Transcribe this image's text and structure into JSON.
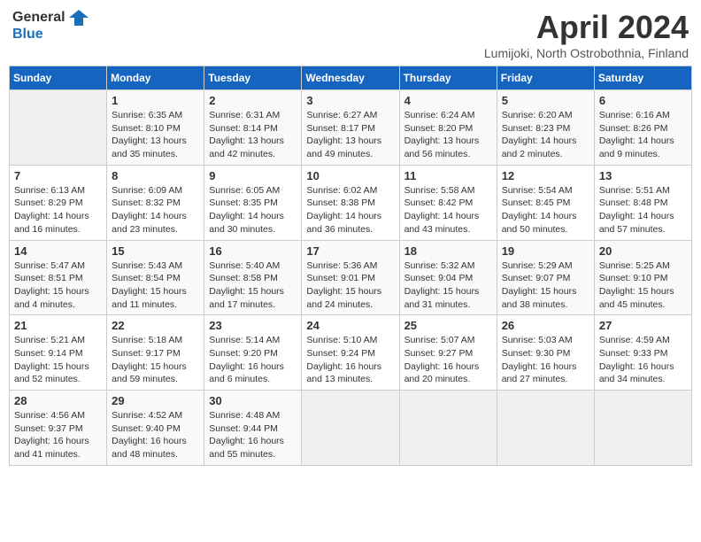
{
  "header": {
    "logo_line1": "General",
    "logo_line2": "Blue",
    "month_title": "April 2024",
    "location": "Lumijoki, North Ostrobothnia, Finland"
  },
  "days_of_week": [
    "Sunday",
    "Monday",
    "Tuesday",
    "Wednesday",
    "Thursday",
    "Friday",
    "Saturday"
  ],
  "weeks": [
    [
      {
        "day": "",
        "info": ""
      },
      {
        "day": "1",
        "info": "Sunrise: 6:35 AM\nSunset: 8:10 PM\nDaylight: 13 hours\nand 35 minutes."
      },
      {
        "day": "2",
        "info": "Sunrise: 6:31 AM\nSunset: 8:14 PM\nDaylight: 13 hours\nand 42 minutes."
      },
      {
        "day": "3",
        "info": "Sunrise: 6:27 AM\nSunset: 8:17 PM\nDaylight: 13 hours\nand 49 minutes."
      },
      {
        "day": "4",
        "info": "Sunrise: 6:24 AM\nSunset: 8:20 PM\nDaylight: 13 hours\nand 56 minutes."
      },
      {
        "day": "5",
        "info": "Sunrise: 6:20 AM\nSunset: 8:23 PM\nDaylight: 14 hours\nand 2 minutes."
      },
      {
        "day": "6",
        "info": "Sunrise: 6:16 AM\nSunset: 8:26 PM\nDaylight: 14 hours\nand 9 minutes."
      }
    ],
    [
      {
        "day": "7",
        "info": "Sunrise: 6:13 AM\nSunset: 8:29 PM\nDaylight: 14 hours\nand 16 minutes."
      },
      {
        "day": "8",
        "info": "Sunrise: 6:09 AM\nSunset: 8:32 PM\nDaylight: 14 hours\nand 23 minutes."
      },
      {
        "day": "9",
        "info": "Sunrise: 6:05 AM\nSunset: 8:35 PM\nDaylight: 14 hours\nand 30 minutes."
      },
      {
        "day": "10",
        "info": "Sunrise: 6:02 AM\nSunset: 8:38 PM\nDaylight: 14 hours\nand 36 minutes."
      },
      {
        "day": "11",
        "info": "Sunrise: 5:58 AM\nSunset: 8:42 PM\nDaylight: 14 hours\nand 43 minutes."
      },
      {
        "day": "12",
        "info": "Sunrise: 5:54 AM\nSunset: 8:45 PM\nDaylight: 14 hours\nand 50 minutes."
      },
      {
        "day": "13",
        "info": "Sunrise: 5:51 AM\nSunset: 8:48 PM\nDaylight: 14 hours\nand 57 minutes."
      }
    ],
    [
      {
        "day": "14",
        "info": "Sunrise: 5:47 AM\nSunset: 8:51 PM\nDaylight: 15 hours\nand 4 minutes."
      },
      {
        "day": "15",
        "info": "Sunrise: 5:43 AM\nSunset: 8:54 PM\nDaylight: 15 hours\nand 11 minutes."
      },
      {
        "day": "16",
        "info": "Sunrise: 5:40 AM\nSunset: 8:58 PM\nDaylight: 15 hours\nand 17 minutes."
      },
      {
        "day": "17",
        "info": "Sunrise: 5:36 AM\nSunset: 9:01 PM\nDaylight: 15 hours\nand 24 minutes."
      },
      {
        "day": "18",
        "info": "Sunrise: 5:32 AM\nSunset: 9:04 PM\nDaylight: 15 hours\nand 31 minutes."
      },
      {
        "day": "19",
        "info": "Sunrise: 5:29 AM\nSunset: 9:07 PM\nDaylight: 15 hours\nand 38 minutes."
      },
      {
        "day": "20",
        "info": "Sunrise: 5:25 AM\nSunset: 9:10 PM\nDaylight: 15 hours\nand 45 minutes."
      }
    ],
    [
      {
        "day": "21",
        "info": "Sunrise: 5:21 AM\nSunset: 9:14 PM\nDaylight: 15 hours\nand 52 minutes."
      },
      {
        "day": "22",
        "info": "Sunrise: 5:18 AM\nSunset: 9:17 PM\nDaylight: 15 hours\nand 59 minutes."
      },
      {
        "day": "23",
        "info": "Sunrise: 5:14 AM\nSunset: 9:20 PM\nDaylight: 16 hours\nand 6 minutes."
      },
      {
        "day": "24",
        "info": "Sunrise: 5:10 AM\nSunset: 9:24 PM\nDaylight: 16 hours\nand 13 minutes."
      },
      {
        "day": "25",
        "info": "Sunrise: 5:07 AM\nSunset: 9:27 PM\nDaylight: 16 hours\nand 20 minutes."
      },
      {
        "day": "26",
        "info": "Sunrise: 5:03 AM\nSunset: 9:30 PM\nDaylight: 16 hours\nand 27 minutes."
      },
      {
        "day": "27",
        "info": "Sunrise: 4:59 AM\nSunset: 9:33 PM\nDaylight: 16 hours\nand 34 minutes."
      }
    ],
    [
      {
        "day": "28",
        "info": "Sunrise: 4:56 AM\nSunset: 9:37 PM\nDaylight: 16 hours\nand 41 minutes."
      },
      {
        "day": "29",
        "info": "Sunrise: 4:52 AM\nSunset: 9:40 PM\nDaylight: 16 hours\nand 48 minutes."
      },
      {
        "day": "30",
        "info": "Sunrise: 4:48 AM\nSunset: 9:44 PM\nDaylight: 16 hours\nand 55 minutes."
      },
      {
        "day": "",
        "info": ""
      },
      {
        "day": "",
        "info": ""
      },
      {
        "day": "",
        "info": ""
      },
      {
        "day": "",
        "info": ""
      }
    ]
  ]
}
